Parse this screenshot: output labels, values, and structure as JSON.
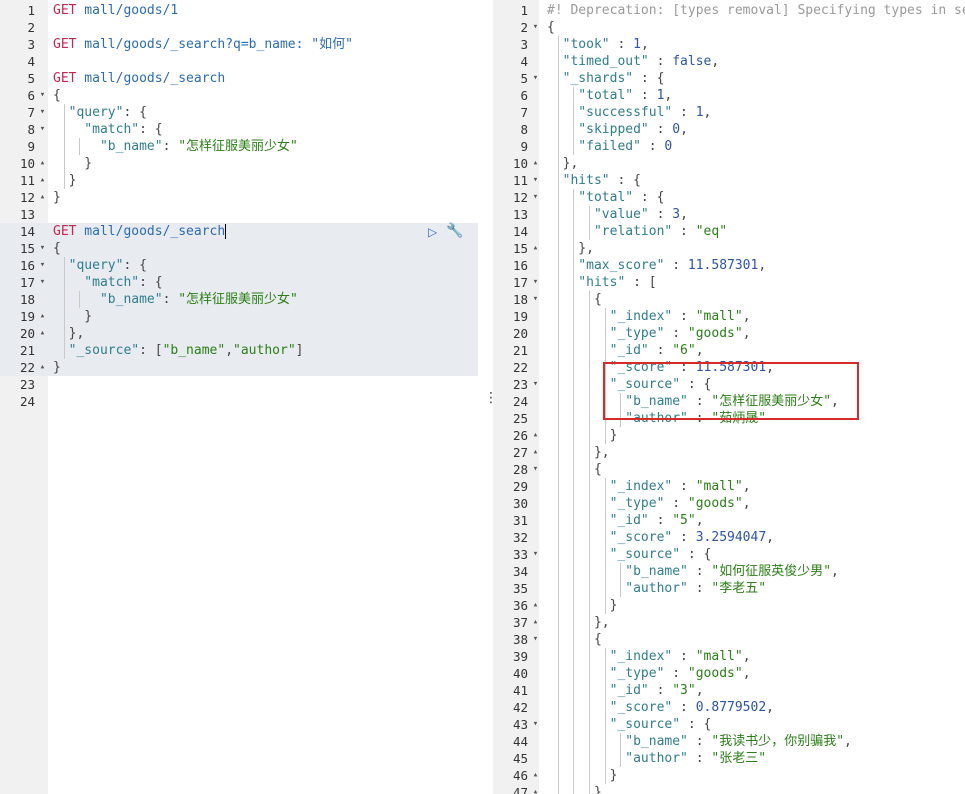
{
  "request_editor": {
    "lines": [
      {
        "n": "1",
        "fold": "",
        "parts": [
          [
            "m",
            "GET"
          ],
          [
            "u",
            " mall/goods/1"
          ]
        ]
      },
      {
        "n": "2",
        "fold": "",
        "parts": []
      },
      {
        "n": "3",
        "fold": "",
        "parts": [
          [
            "m",
            "GET"
          ],
          [
            "u",
            " mall/goods/_search?q=b_name: \"如何\""
          ]
        ]
      },
      {
        "n": "4",
        "fold": "",
        "parts": []
      },
      {
        "n": "5",
        "fold": "",
        "parts": [
          [
            "m",
            "GET"
          ],
          [
            "u",
            " mall/goods/_search"
          ]
        ]
      },
      {
        "n": "6",
        "fold": "▾",
        "parts": [
          [
            "p",
            "{"
          ]
        ]
      },
      {
        "n": "7",
        "fold": "▾",
        "parts": [
          [
            "k",
            "  \"query\""
          ],
          [
            "p",
            ": {"
          ]
        ]
      },
      {
        "n": "8",
        "fold": "▾",
        "parts": [
          [
            "k",
            "    \"match\""
          ],
          [
            "p",
            ": {"
          ]
        ]
      },
      {
        "n": "9",
        "fold": "",
        "parts": [
          [
            "k",
            "      \"b_name\""
          ],
          [
            "p",
            ": "
          ],
          [
            "s",
            "\"怎样征服美丽少女\""
          ]
        ]
      },
      {
        "n": "10",
        "fold": "▴",
        "parts": [
          [
            "p",
            "    }"
          ]
        ]
      },
      {
        "n": "11",
        "fold": "▴",
        "parts": [
          [
            "p",
            "  }"
          ]
        ]
      },
      {
        "n": "12",
        "fold": "▴",
        "parts": [
          [
            "p",
            "}"
          ]
        ]
      },
      {
        "n": "13",
        "fold": "",
        "parts": []
      },
      {
        "n": "14",
        "fold": "",
        "hl": true,
        "cursor": true,
        "parts": [
          [
            "m",
            "GET"
          ],
          [
            "u",
            " mall/goods/_search"
          ]
        ]
      },
      {
        "n": "15",
        "fold": "▾",
        "hl": true,
        "parts": [
          [
            "p",
            "{"
          ]
        ]
      },
      {
        "n": "16",
        "fold": "▾",
        "hl": true,
        "parts": [
          [
            "k",
            "  \"query\""
          ],
          [
            "p",
            ": {"
          ]
        ]
      },
      {
        "n": "17",
        "fold": "▾",
        "hl": true,
        "parts": [
          [
            "k",
            "    \"match\""
          ],
          [
            "p",
            ": {"
          ]
        ]
      },
      {
        "n": "18",
        "fold": "",
        "hl": true,
        "parts": [
          [
            "k",
            "      \"b_name\""
          ],
          [
            "p",
            ": "
          ],
          [
            "s",
            "\"怎样征服美丽少女\""
          ]
        ]
      },
      {
        "n": "19",
        "fold": "▴",
        "hl": true,
        "parts": [
          [
            "p",
            "    }"
          ]
        ]
      },
      {
        "n": "20",
        "fold": "▴",
        "hl": true,
        "parts": [
          [
            "p",
            "  },"
          ]
        ]
      },
      {
        "n": "21",
        "fold": "",
        "hl": true,
        "parts": [
          [
            "k",
            "  \"_source\""
          ],
          [
            "p",
            ": ["
          ],
          [
            "s",
            "\"b_name\""
          ],
          [
            "p",
            ","
          ],
          [
            "s",
            "\"author\""
          ],
          [
            "p",
            "]"
          ]
        ]
      },
      {
        "n": "22",
        "fold": "▴",
        "hl": true,
        "parts": [
          [
            "p",
            "}"
          ]
        ]
      },
      {
        "n": "23",
        "fold": "",
        "parts": []
      },
      {
        "n": "24",
        "fold": "",
        "parts": []
      }
    ]
  },
  "response_viewer": {
    "lines": [
      {
        "n": "1",
        "fold": "",
        "parts": [
          [
            "t",
            "#! Deprecation: [types removal] Specifying types in sea"
          ]
        ]
      },
      {
        "n": "2",
        "fold": "▾",
        "parts": [
          [
            "p",
            "{"
          ]
        ]
      },
      {
        "n": "3",
        "fold": "",
        "parts": [
          [
            "k",
            "  \"took\""
          ],
          [
            "p",
            " : "
          ],
          [
            "n",
            "1"
          ],
          [
            "p",
            ","
          ]
        ]
      },
      {
        "n": "4",
        "fold": "",
        "parts": [
          [
            "k",
            "  \"timed_out\""
          ],
          [
            "p",
            " : "
          ],
          [
            "n",
            "false"
          ],
          [
            "p",
            ","
          ]
        ]
      },
      {
        "n": "5",
        "fold": "▾",
        "parts": [
          [
            "k",
            "  \"_shards\""
          ],
          [
            "p",
            " : {"
          ]
        ]
      },
      {
        "n": "6",
        "fold": "",
        "parts": [
          [
            "k",
            "    \"total\""
          ],
          [
            "p",
            " : "
          ],
          [
            "n",
            "1"
          ],
          [
            "p",
            ","
          ]
        ]
      },
      {
        "n": "7",
        "fold": "",
        "parts": [
          [
            "k",
            "    \"successful\""
          ],
          [
            "p",
            " : "
          ],
          [
            "n",
            "1"
          ],
          [
            "p",
            ","
          ]
        ]
      },
      {
        "n": "8",
        "fold": "",
        "parts": [
          [
            "k",
            "    \"skipped\""
          ],
          [
            "p",
            " : "
          ],
          [
            "n",
            "0"
          ],
          [
            "p",
            ","
          ]
        ]
      },
      {
        "n": "9",
        "fold": "",
        "parts": [
          [
            "k",
            "    \"failed\""
          ],
          [
            "p",
            " : "
          ],
          [
            "n",
            "0"
          ]
        ]
      },
      {
        "n": "10",
        "fold": "▴",
        "parts": [
          [
            "p",
            "  },"
          ]
        ]
      },
      {
        "n": "11",
        "fold": "▾",
        "parts": [
          [
            "k",
            "  \"hits\""
          ],
          [
            "p",
            " : {"
          ]
        ]
      },
      {
        "n": "12",
        "fold": "▾",
        "parts": [
          [
            "k",
            "    \"total\""
          ],
          [
            "p",
            " : {"
          ]
        ]
      },
      {
        "n": "13",
        "fold": "",
        "parts": [
          [
            "k",
            "      \"value\""
          ],
          [
            "p",
            " : "
          ],
          [
            "n",
            "3"
          ],
          [
            "p",
            ","
          ]
        ]
      },
      {
        "n": "14",
        "fold": "",
        "parts": [
          [
            "k",
            "      \"relation\""
          ],
          [
            "p",
            " : "
          ],
          [
            "s",
            "\"eq\""
          ]
        ]
      },
      {
        "n": "15",
        "fold": "▴",
        "parts": [
          [
            "p",
            "    },"
          ]
        ]
      },
      {
        "n": "16",
        "fold": "",
        "parts": [
          [
            "k",
            "    \"max_score\""
          ],
          [
            "p",
            " : "
          ],
          [
            "n",
            "11.587301"
          ],
          [
            "p",
            ","
          ]
        ]
      },
      {
        "n": "17",
        "fold": "▾",
        "parts": [
          [
            "k",
            "    \"hits\""
          ],
          [
            "p",
            " : ["
          ]
        ]
      },
      {
        "n": "18",
        "fold": "▾",
        "parts": [
          [
            "p",
            "      {"
          ]
        ]
      },
      {
        "n": "19",
        "fold": "",
        "parts": [
          [
            "k",
            "        \"_index\""
          ],
          [
            "p",
            " : "
          ],
          [
            "s",
            "\"mall\""
          ],
          [
            "p",
            ","
          ]
        ]
      },
      {
        "n": "20",
        "fold": "",
        "parts": [
          [
            "k",
            "        \"_type\""
          ],
          [
            "p",
            " : "
          ],
          [
            "s",
            "\"goods\""
          ],
          [
            "p",
            ","
          ]
        ]
      },
      {
        "n": "21",
        "fold": "",
        "parts": [
          [
            "k",
            "        \"_id\""
          ],
          [
            "p",
            " : "
          ],
          [
            "s",
            "\"6\""
          ],
          [
            "p",
            ","
          ]
        ]
      },
      {
        "n": "22",
        "fold": "",
        "parts": [
          [
            "k",
            "        \"_score\""
          ],
          [
            "p",
            " : "
          ],
          [
            "n",
            "11.587301"
          ],
          [
            "p",
            ","
          ]
        ]
      },
      {
        "n": "23",
        "fold": "▾",
        "parts": [
          [
            "k",
            "        \"_source\""
          ],
          [
            "p",
            " : {"
          ]
        ]
      },
      {
        "n": "24",
        "fold": "",
        "parts": [
          [
            "k",
            "          \"b_name\""
          ],
          [
            "p",
            " : "
          ],
          [
            "s",
            "\"怎样征服美丽少女\""
          ],
          [
            "p",
            ","
          ]
        ]
      },
      {
        "n": "25",
        "fold": "",
        "parts": [
          [
            "k",
            "          \"author\""
          ],
          [
            "p",
            " : "
          ],
          [
            "s",
            "\"茹炳晟\""
          ]
        ]
      },
      {
        "n": "26",
        "fold": "▴",
        "parts": [
          [
            "p",
            "        }"
          ]
        ]
      },
      {
        "n": "27",
        "fold": "▴",
        "parts": [
          [
            "p",
            "      },"
          ]
        ]
      },
      {
        "n": "28",
        "fold": "▾",
        "parts": [
          [
            "p",
            "      {"
          ]
        ]
      },
      {
        "n": "29",
        "fold": "",
        "parts": [
          [
            "k",
            "        \"_index\""
          ],
          [
            "p",
            " : "
          ],
          [
            "s",
            "\"mall\""
          ],
          [
            "p",
            ","
          ]
        ]
      },
      {
        "n": "30",
        "fold": "",
        "parts": [
          [
            "k",
            "        \"_type\""
          ],
          [
            "p",
            " : "
          ],
          [
            "s",
            "\"goods\""
          ],
          [
            "p",
            ","
          ]
        ]
      },
      {
        "n": "31",
        "fold": "",
        "parts": [
          [
            "k",
            "        \"_id\""
          ],
          [
            "p",
            " : "
          ],
          [
            "s",
            "\"5\""
          ],
          [
            "p",
            ","
          ]
        ]
      },
      {
        "n": "32",
        "fold": "",
        "parts": [
          [
            "k",
            "        \"_score\""
          ],
          [
            "p",
            " : "
          ],
          [
            "n",
            "3.2594047"
          ],
          [
            "p",
            ","
          ]
        ]
      },
      {
        "n": "33",
        "fold": "▾",
        "parts": [
          [
            "k",
            "        \"_source\""
          ],
          [
            "p",
            " : {"
          ]
        ]
      },
      {
        "n": "34",
        "fold": "",
        "parts": [
          [
            "k",
            "          \"b_name\""
          ],
          [
            "p",
            " : "
          ],
          [
            "s",
            "\"如何征服英俊少男\""
          ],
          [
            "p",
            ","
          ]
        ]
      },
      {
        "n": "35",
        "fold": "",
        "parts": [
          [
            "k",
            "          \"author\""
          ],
          [
            "p",
            " : "
          ],
          [
            "s",
            "\"李老五\""
          ]
        ]
      },
      {
        "n": "36",
        "fold": "▴",
        "parts": [
          [
            "p",
            "        }"
          ]
        ]
      },
      {
        "n": "37",
        "fold": "▴",
        "parts": [
          [
            "p",
            "      },"
          ]
        ]
      },
      {
        "n": "38",
        "fold": "▾",
        "parts": [
          [
            "p",
            "      {"
          ]
        ]
      },
      {
        "n": "39",
        "fold": "",
        "parts": [
          [
            "k",
            "        \"_index\""
          ],
          [
            "p",
            " : "
          ],
          [
            "s",
            "\"mall\""
          ],
          [
            "p",
            ","
          ]
        ]
      },
      {
        "n": "40",
        "fold": "",
        "parts": [
          [
            "k",
            "        \"_type\""
          ],
          [
            "p",
            " : "
          ],
          [
            "s",
            "\"goods\""
          ],
          [
            "p",
            ","
          ]
        ]
      },
      {
        "n": "41",
        "fold": "",
        "parts": [
          [
            "k",
            "        \"_id\""
          ],
          [
            "p",
            " : "
          ],
          [
            "s",
            "\"3\""
          ],
          [
            "p",
            ","
          ]
        ]
      },
      {
        "n": "42",
        "fold": "",
        "parts": [
          [
            "k",
            "        \"_score\""
          ],
          [
            "p",
            " : "
          ],
          [
            "n",
            "0.8779502"
          ],
          [
            "p",
            ","
          ]
        ]
      },
      {
        "n": "43",
        "fold": "▾",
        "parts": [
          [
            "k",
            "        \"_source\""
          ],
          [
            "p",
            " : {"
          ]
        ]
      },
      {
        "n": "44",
        "fold": "",
        "parts": [
          [
            "k",
            "          \"b_name\""
          ],
          [
            "p",
            " : "
          ],
          [
            "s",
            "\"我读书少，你别骗我\""
          ],
          [
            "p",
            ","
          ]
        ]
      },
      {
        "n": "45",
        "fold": "",
        "parts": [
          [
            "k",
            "          \"author\""
          ],
          [
            "p",
            " : "
          ],
          [
            "s",
            "\"张老三\""
          ]
        ]
      },
      {
        "n": "46",
        "fold": "▴",
        "parts": [
          [
            "p",
            "        }"
          ]
        ]
      },
      {
        "n": "47",
        "fold": "▴",
        "parts": [
          [
            "p",
            "      }"
          ]
        ]
      }
    ]
  },
  "icons": {
    "play": "▷",
    "wrench": "🔧",
    "drag_handle": "⋮"
  },
  "colors": {
    "method": "#c7254e",
    "url": "#2b6cb0",
    "key": "#2f7e8d",
    "string": "#2a7f16",
    "number": "#2a55a8",
    "highlight_box": "#d62b2b"
  }
}
